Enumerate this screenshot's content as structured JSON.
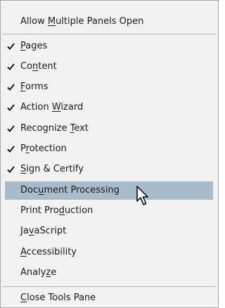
{
  "menu": {
    "top": {
      "before": "Allow ",
      "key": "M",
      "after": "ultiple Panels Open"
    },
    "items": [
      {
        "checked": true,
        "before": "",
        "key": "P",
        "after": "ages"
      },
      {
        "checked": true,
        "before": "Co",
        "key": "n",
        "after": "tent"
      },
      {
        "checked": true,
        "before": "",
        "key": "F",
        "after": "orms"
      },
      {
        "checked": true,
        "before": "Action ",
        "key": "W",
        "after": "izard"
      },
      {
        "checked": true,
        "before": "Recognize ",
        "key": "T",
        "after": "ext"
      },
      {
        "checked": true,
        "before": "P",
        "key": "r",
        "after": "otection"
      },
      {
        "checked": true,
        "before": "",
        "key": "S",
        "after": "ign & Certify"
      },
      {
        "checked": false,
        "before": "Doc",
        "key": "u",
        "after": "ment Processing"
      },
      {
        "checked": false,
        "before": "Print Pro",
        "key": "d",
        "after": "uction"
      },
      {
        "checked": false,
        "before": "Ja",
        "key": "v",
        "after": "aScript"
      },
      {
        "checked": false,
        "before": "",
        "key": "A",
        "after": "ccessibility"
      },
      {
        "checked": false,
        "before": "Analy",
        "key": "z",
        "after": "e"
      }
    ],
    "bottom": {
      "before": "",
      "key": "C",
      "after": "lose Tools Pane"
    },
    "highlighted_label": "Document Processing",
    "highlight_color": "#a9bccb",
    "check_icon": "checkmark-icon",
    "cursor_icon": "mouse-pointer-icon"
  }
}
